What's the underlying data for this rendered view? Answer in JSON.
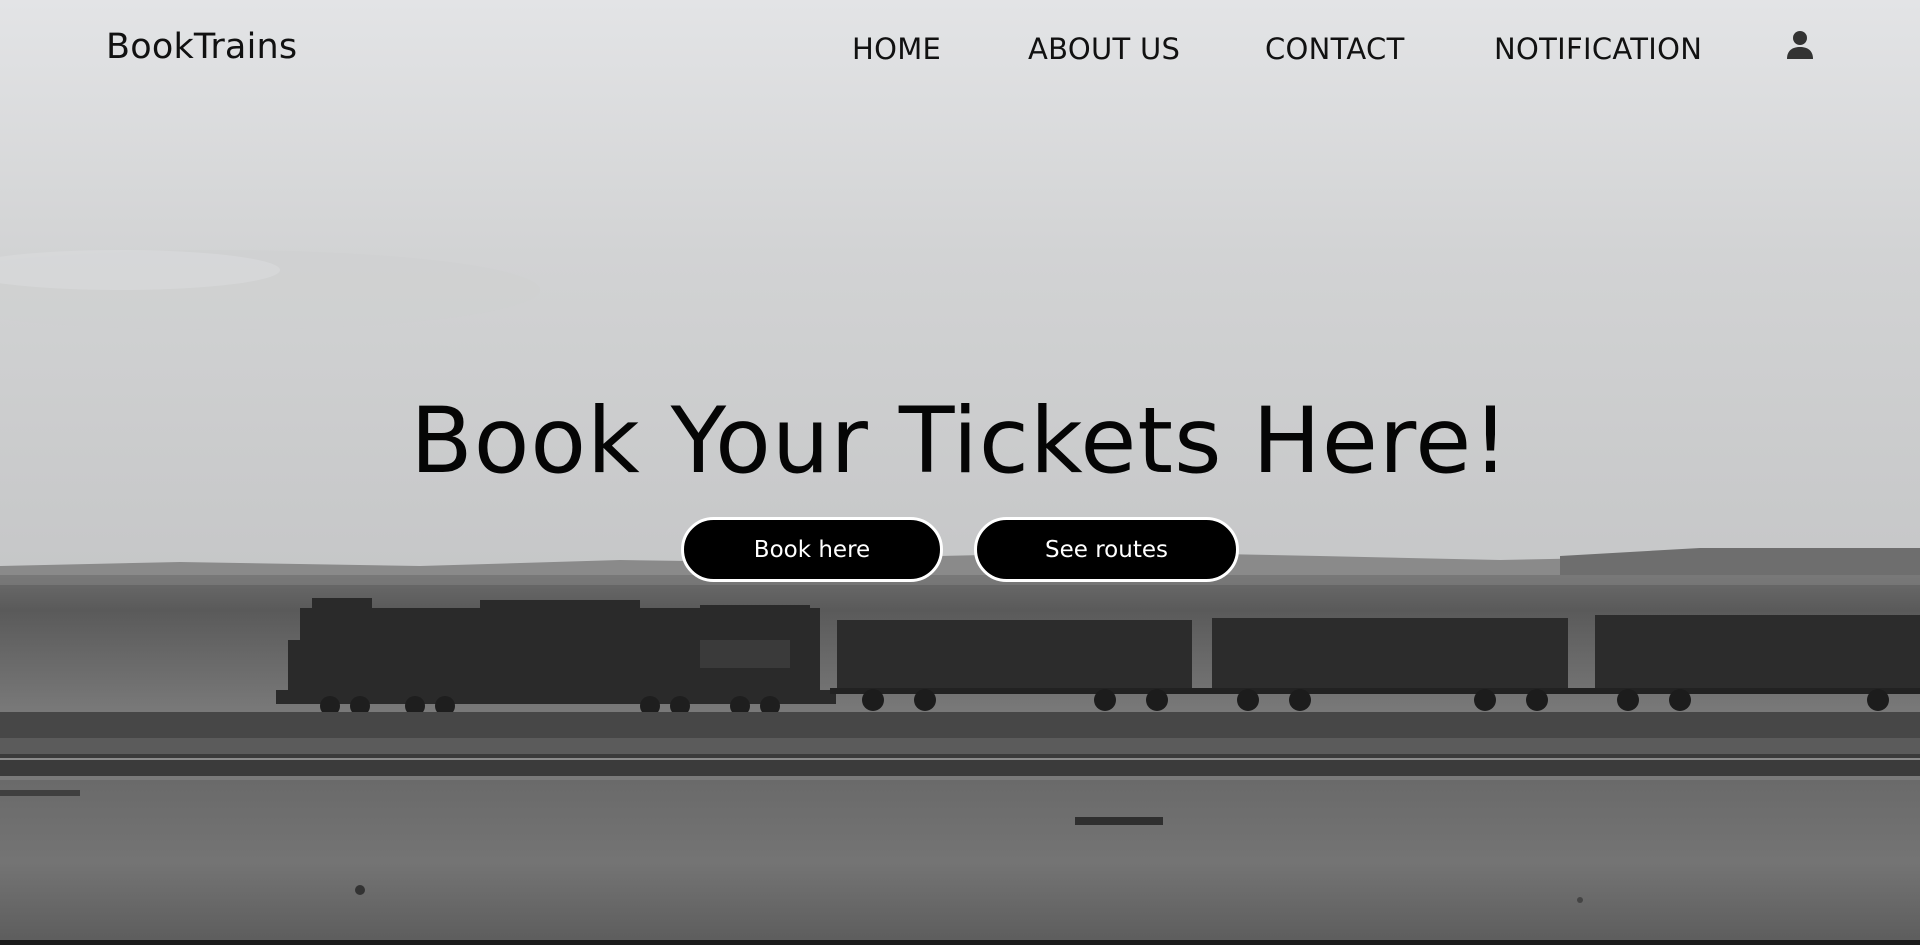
{
  "header": {
    "brand": "BookTrains",
    "nav": {
      "home": "HOME",
      "about": "ABOUT US",
      "contact": "CONTACT",
      "notification": "NOTIFICATION"
    },
    "user_icon": "user-icon"
  },
  "hero": {
    "title": "Book Your Tickets Here!",
    "book_button": "Book here",
    "routes_button": "See routes"
  },
  "colors": {
    "button_bg": "#000000",
    "button_text": "#ffffff",
    "nav_text": "#111111"
  }
}
